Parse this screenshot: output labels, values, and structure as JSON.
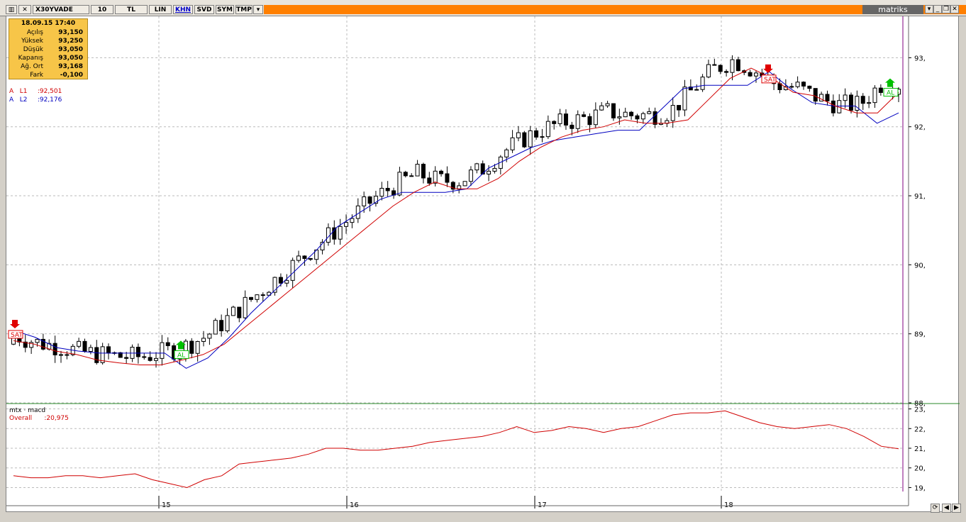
{
  "toolbar": {
    "symbol": "X30YVADE",
    "period": "10",
    "currency": "TL",
    "scale": "LIN",
    "buttons": [
      "KHN",
      "SVD",
      "SYM",
      "TMP"
    ],
    "brand": "matriks"
  },
  "info": {
    "datetime": "18.09.15 17:40",
    "rows": [
      {
        "k": "Açılış",
        "v": "93,150"
      },
      {
        "k": "Yüksek",
        "v": "93,250"
      },
      {
        "k": "Düşük",
        "v": "93,050"
      },
      {
        "k": "Kapanış",
        "v": "93,050"
      },
      {
        "k": "Ağ. Ort",
        "v": "93,168"
      },
      {
        "k": "Fark",
        "v": "-0,100"
      }
    ]
  },
  "indicators": {
    "l1": {
      "prefix": "A",
      "name": "L1",
      "value": ":92,501",
      "color": "#d00000"
    },
    "l2": {
      "prefix": "A",
      "name": "L2",
      "value": ":92,176",
      "color": "#0000c0"
    }
  },
  "macd": {
    "title": "mtx · macd",
    "label": "Overall",
    "value": ":20,975",
    "color": "#d00000"
  },
  "signals": {
    "sell": "SAT",
    "buy": "AL"
  },
  "chart_data": [
    {
      "type": "line",
      "panel": "price",
      "ylim": [
        88,
        93.6
      ],
      "y_ticks": [
        "93,",
        "92,",
        "91,",
        "90,",
        "89,",
        "88,"
      ],
      "x_ticks": [
        "15",
        "16",
        "17",
        "18"
      ],
      "series": [
        {
          "name": "L1",
          "values": [
            88.9,
            88.85,
            88.75,
            88.7,
            88.62,
            88.58,
            88.55,
            88.55,
            88.62,
            88.7,
            88.85,
            89.1,
            89.35,
            89.6,
            89.85,
            90.1,
            90.35,
            90.6,
            90.85,
            91.05,
            91.2,
            91.1,
            91.1,
            91.25,
            91.5,
            91.7,
            91.85,
            91.95,
            92.0,
            92.1,
            92.05,
            92.05,
            92.1,
            92.4,
            92.7,
            92.85,
            92.7,
            92.5,
            92.45,
            92.3,
            92.2,
            92.2,
            92.5
          ]
        },
        {
          "name": "L2",
          "values": [
            89.05,
            88.95,
            88.8,
            88.75,
            88.72,
            88.72,
            88.72,
            88.72,
            88.5,
            88.65,
            88.95,
            89.3,
            89.6,
            89.9,
            90.2,
            90.55,
            90.75,
            90.95,
            91.05,
            91.05,
            91.05,
            91.1,
            91.4,
            91.55,
            91.7,
            91.8,
            91.85,
            91.9,
            91.95,
            91.95,
            92.25,
            92.55,
            92.6,
            92.6,
            92.6,
            92.8,
            92.55,
            92.35,
            92.3,
            92.3,
            92.05,
            92.2
          ]
        }
      ]
    },
    {
      "type": "line",
      "panel": "macd",
      "ylim": [
        18.8,
        23.2
      ],
      "y_ticks": [
        "23,",
        "22,",
        "21,",
        "20,",
        "19,"
      ],
      "series": [
        {
          "name": "Overall",
          "values": [
            19.6,
            19.5,
            19.5,
            19.6,
            19.6,
            19.5,
            19.6,
            19.7,
            19.4,
            19.2,
            19.0,
            19.4,
            19.6,
            20.2,
            20.3,
            20.4,
            20.5,
            20.7,
            21.0,
            21.0,
            20.9,
            20.9,
            21.0,
            21.1,
            21.3,
            21.4,
            21.5,
            21.6,
            21.8,
            22.1,
            21.8,
            21.9,
            22.1,
            22.0,
            21.8,
            22.0,
            22.1,
            22.4,
            22.7,
            22.8,
            22.8,
            22.9,
            22.6,
            22.3,
            22.1,
            22.0,
            22.1,
            22.2,
            22.0,
            21.6,
            21.1,
            20.975
          ]
        }
      ]
    }
  ]
}
